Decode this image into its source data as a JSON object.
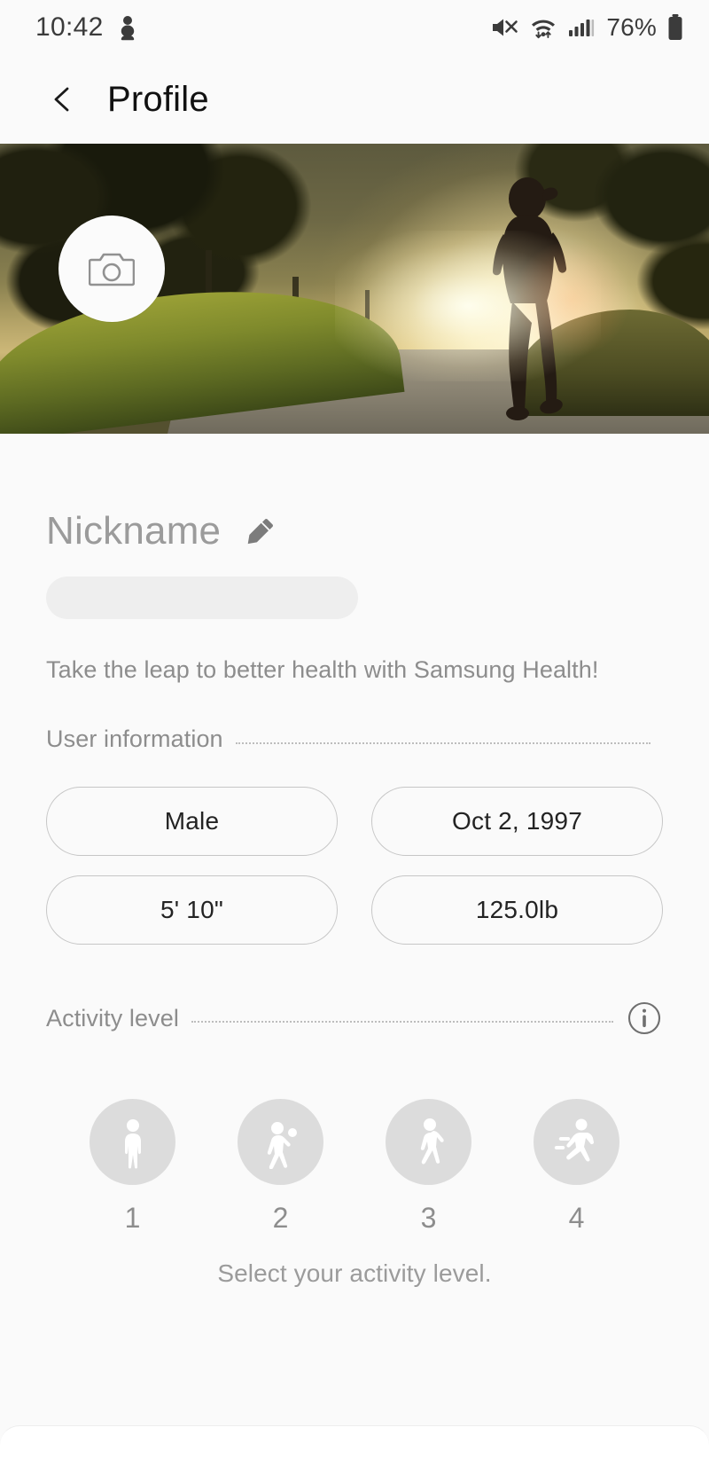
{
  "status_bar": {
    "time": "10:42",
    "left_icons": [
      "do-not-disturb-icon"
    ],
    "right_icons": [
      "mute-icon",
      "wifi-icon",
      "cellular-signal-icon"
    ],
    "battery_percent": "76%",
    "battery_icon": "battery-icon"
  },
  "app_bar": {
    "back_icon": "back-chevron-icon",
    "title": "Profile"
  },
  "hero": {
    "avatar": {
      "icon": "camera-icon",
      "label": "Change profile photo"
    }
  },
  "profile": {
    "nickname_placeholder": "Nickname",
    "nickname_value": "",
    "edit_icon": "pencil-icon",
    "tagline": "Take the leap to better health with Samsung Health!"
  },
  "user_information": {
    "title": "User information",
    "fields": [
      {
        "name": "gender",
        "value": "Male"
      },
      {
        "name": "birthdate",
        "value": "Oct 2, 1997"
      },
      {
        "name": "height",
        "value": "5' 10\""
      },
      {
        "name": "weight",
        "value": "125.0lb"
      }
    ]
  },
  "activity_level": {
    "title": "Activity level",
    "info_icon": "info-icon",
    "levels": [
      {
        "label": "1",
        "icon": "standing-person-icon"
      },
      {
        "label": "2",
        "icon": "stretching-person-icon"
      },
      {
        "label": "3",
        "icon": "walking-person-icon"
      },
      {
        "label": "4",
        "icon": "running-person-icon"
      }
    ],
    "hint": "Select your activity level."
  },
  "colors": {
    "page_background": "#fafafa",
    "text_primary": "#111111",
    "text_secondary": "#8d8d8d",
    "pill_border": "#c6c6c6",
    "activity_circle": "#dcdcdc",
    "skeleton": "#eeeeee"
  }
}
